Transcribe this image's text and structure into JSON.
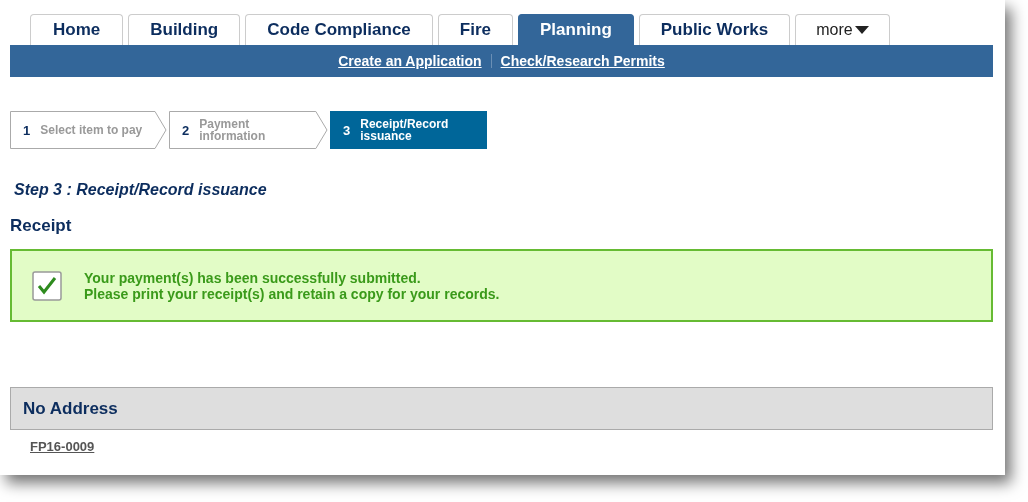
{
  "tabs": [
    {
      "label": "Home",
      "selected": false,
      "kind": "tab"
    },
    {
      "label": "Building",
      "selected": false,
      "kind": "tab"
    },
    {
      "label": "Code Compliance",
      "selected": false,
      "kind": "tab"
    },
    {
      "label": "Fire",
      "selected": false,
      "kind": "tab"
    },
    {
      "label": "Planning",
      "selected": true,
      "kind": "tab"
    },
    {
      "label": "Public Works",
      "selected": false,
      "kind": "tab"
    },
    {
      "label": "more",
      "selected": false,
      "kind": "dropdown"
    }
  ],
  "sub_links": [
    "Create an Application",
    "Check/Research Permits"
  ],
  "steps": [
    {
      "number": "1",
      "label": "Select item to pay",
      "selected": false
    },
    {
      "number": "2",
      "label": "Payment information",
      "selected": false
    },
    {
      "number": "3",
      "label": "Receipt/Record issuance",
      "selected": true
    }
  ],
  "step_heading": "Step 3 : Receipt/Record issuance",
  "section_title": "Receipt",
  "message": {
    "lines": [
      "Your payment(s) has been successfully submitted.",
      "Please print your receipt(s) and retain a copy for your records."
    ]
  },
  "address": {
    "title": "No Address",
    "records": [
      "FP16-0009"
    ]
  }
}
